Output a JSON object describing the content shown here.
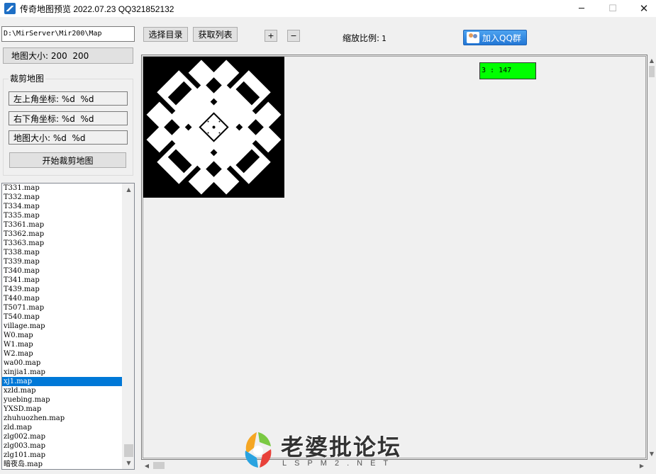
{
  "window": {
    "title": "传奇地图预览 2022.07.23 QQ321852132",
    "minimize_glyph": "─",
    "maximize_glyph": "☐",
    "close_glyph": "✕"
  },
  "toolbar": {
    "path_value": "D:\\MirServer\\Mir200\\Map",
    "select_dir_label": "选择目录",
    "fetch_list_label": "获取列表",
    "zoom_in_label": "+",
    "zoom_out_label": "−",
    "zoom_label": "缩放比例:",
    "zoom_value": "1",
    "qq_group_label": "加入QQ群"
  },
  "left_panel": {
    "map_size_label": "地图大小: 200  200",
    "crop_group_title": "裁剪地图",
    "top_left_label": "左上角坐标: %d  %d",
    "bottom_right_label": "右下角坐标: %d  %d",
    "crop_size_label": "地图大小: %d  %d",
    "start_crop_label": "开始裁剪地图"
  },
  "file_list": {
    "selected": "xj1.map",
    "items": [
      "T331.map",
      "T332.map",
      "T334.map",
      "T335.map",
      "T3361.map",
      "T3362.map",
      "T3363.map",
      "T338.map",
      "T339.map",
      "T340.map",
      "T341.map",
      "T439.map",
      "T440.map",
      "T5071.map",
      "T540.map",
      "village.map",
      "W0.map",
      "W1.map",
      "W2.map",
      "wa00.map",
      "xinjia1.map",
      "xj1.map",
      "xzld.map",
      "yuebing.map",
      "YXSD.map",
      "zhuhuozhen.map",
      "zld.map",
      "zlg002.map",
      "zlg003.map",
      "zlg101.map",
      "暗夜岛.map"
    ]
  },
  "map_view": {
    "coord_readout": "3 : 147"
  },
  "watermark": {
    "text": "老婆批论坛",
    "sub": "LSPM2.NET"
  },
  "icons": {
    "app": "app-icon",
    "qq": "qq-group-icon",
    "scroll_up": "scroll-up-icon",
    "scroll_down": "scroll-down-icon"
  }
}
